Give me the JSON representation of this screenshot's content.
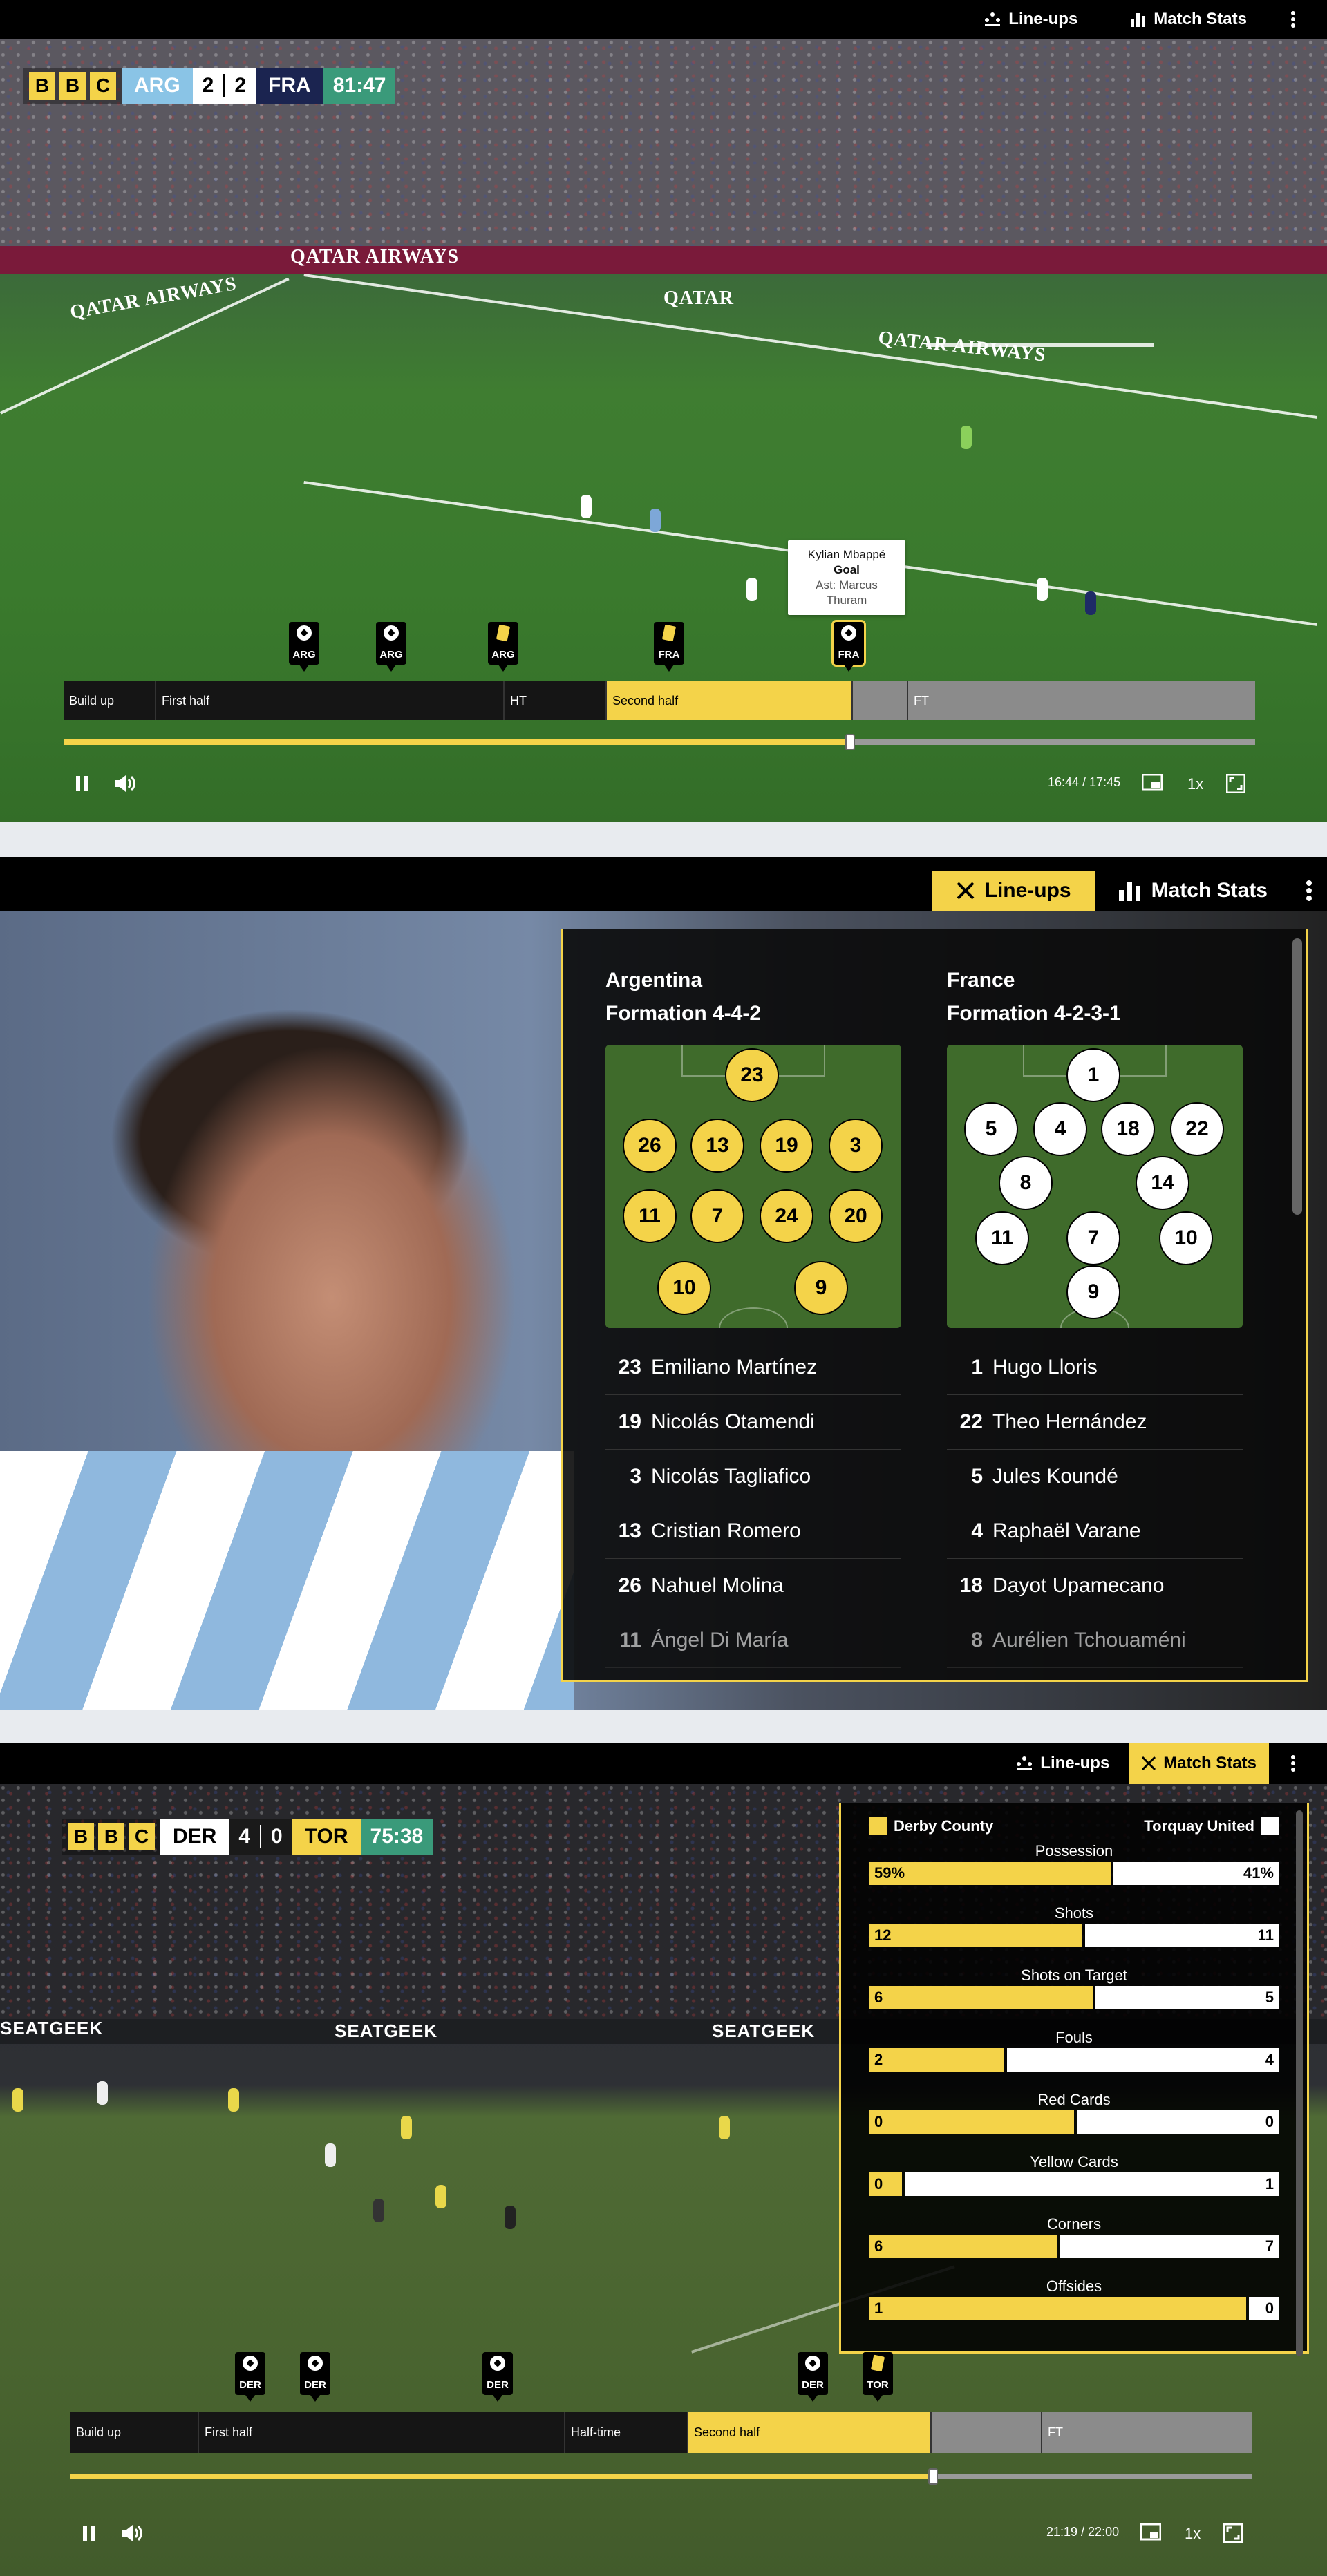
{
  "panel1": {
    "topbar": {
      "lineups": "Line-ups",
      "stats": "Match Stats"
    },
    "scoreboard": {
      "bbc": [
        "B",
        "B",
        "C"
      ],
      "home": "ARG",
      "home_score": "2",
      "away_score": "2",
      "away": "FRA",
      "clock": "81:47"
    },
    "tooltip": {
      "player": "Kylian Mbappé",
      "event": "Goal",
      "assist": "Ast: Marcus Thuram"
    },
    "markers": [
      {
        "team": "ARG",
        "type": "goal"
      },
      {
        "team": "ARG",
        "type": "goal"
      },
      {
        "team": "ARG",
        "type": "yellow"
      },
      {
        "team": "FRA",
        "type": "yellow"
      },
      {
        "team": "FRA",
        "type": "goal"
      }
    ],
    "segments": [
      "Build up",
      "First half",
      "HT",
      "Second half",
      "",
      "FT"
    ],
    "progress": 0.66,
    "time": "16:44 / 17:45",
    "speed": "1x",
    "banners": [
      "QATAR AIRWAYS",
      "QATAR AIRWAYS",
      "QATAR",
      "QATAR AIRWAYS"
    ]
  },
  "panel2": {
    "tabs": {
      "lineups": "Line-ups",
      "stats": "Match Stats"
    },
    "argentina": {
      "name": "Argentina",
      "formation": "Formation 4-4-2",
      "pitch": [
        "23",
        "26",
        "13",
        "19",
        "3",
        "11",
        "7",
        "24",
        "20",
        "10",
        "9"
      ],
      "players": [
        {
          "num": "23",
          "name": "Emiliano Martínez"
        },
        {
          "num": "19",
          "name": "Nicolás Otamendi"
        },
        {
          "num": "3",
          "name": "Nicolás Tagliafico"
        },
        {
          "num": "13",
          "name": "Cristian Romero"
        },
        {
          "num": "26",
          "name": "Nahuel Molina"
        },
        {
          "num": "11",
          "name": "Ángel Di María"
        }
      ]
    },
    "france": {
      "name": "France",
      "formation": "Formation 4-2-3-1",
      "pitch": [
        "1",
        "5",
        "4",
        "18",
        "22",
        "8",
        "14",
        "11",
        "7",
        "10",
        "9"
      ],
      "players": [
        {
          "num": "1",
          "name": "Hugo Lloris"
        },
        {
          "num": "22",
          "name": "Theo Hernández"
        },
        {
          "num": "5",
          "name": "Jules Koundé"
        },
        {
          "num": "4",
          "name": "Raphaël Varane"
        },
        {
          "num": "18",
          "name": "Dayot Upamecano"
        },
        {
          "num": "8",
          "name": "Aurélien Tchouaméni"
        }
      ]
    }
  },
  "panel3": {
    "topbar": {
      "lineups": "Line-ups",
      "stats": "Match Stats"
    },
    "scoreboard": {
      "bbc": [
        "B",
        "B",
        "C"
      ],
      "home": "DER",
      "home_score": "4",
      "away_score": "0",
      "away": "TOR",
      "clock": "75:38"
    },
    "stats_header": {
      "home": "Derby County",
      "away": "Torquay United"
    },
    "stats": [
      {
        "label": "Possession",
        "home": "59%",
        "away": "41%",
        "home_frac": 0.59
      },
      {
        "label": "Shots",
        "home": "12",
        "away": "11",
        "home_frac": 0.52
      },
      {
        "label": "Shots on Target",
        "home": "6",
        "away": "5",
        "home_frac": 0.545
      },
      {
        "label": "Fouls",
        "home": "2",
        "away": "4",
        "home_frac": 0.33
      },
      {
        "label": "Red Cards",
        "home": "0",
        "away": "0",
        "home_frac": 0.5
      },
      {
        "label": "Yellow Cards",
        "home": "0",
        "away": "1",
        "home_frac": 0.08
      },
      {
        "label": "Corners",
        "home": "6",
        "away": "7",
        "home_frac": 0.46
      },
      {
        "label": "Offsides",
        "home": "1",
        "away": "0",
        "home_frac": 0.92
      }
    ],
    "markers": [
      {
        "team": "DER",
        "type": "goal"
      },
      {
        "team": "DER",
        "type": "goal"
      },
      {
        "team": "DER",
        "type": "goal"
      },
      {
        "team": "DER",
        "type": "goal"
      },
      {
        "team": "TOR",
        "type": "yellow"
      }
    ],
    "segments": [
      "Build up",
      "First half",
      "Half-time",
      "Second half",
      "",
      "FT"
    ],
    "progress": 0.73,
    "time": "21:19 / 22:00",
    "speed": "1x",
    "banners": [
      "SEATGEEK",
      "SEATGEEK",
      "SEATGEEK"
    ]
  },
  "colors": {
    "accent": "#f4d349",
    "clock": "#3a9a7a",
    "home_team_p1": "#8ac4e6"
  }
}
